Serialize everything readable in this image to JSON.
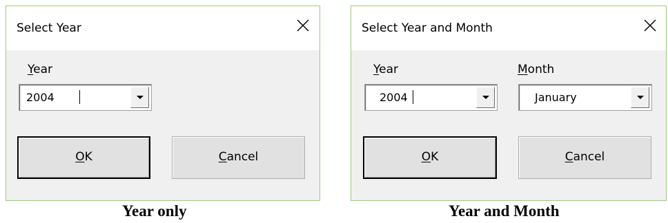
{
  "dialogs": [
    {
      "title": "Select Year",
      "year_label": {
        "mnemonic": "Y",
        "rest": "ear"
      },
      "year_value": "2004",
      "ok": {
        "mnemonic": "O",
        "rest": "K"
      },
      "cancel": {
        "mnemonic": "C",
        "rest": "ancel"
      }
    },
    {
      "title": "Select Year and Month",
      "year_label": {
        "mnemonic": "Y",
        "rest": "ear"
      },
      "year_value": "2004",
      "month_label": {
        "mnemonic": "M",
        "rest": "onth"
      },
      "month_value": "January",
      "ok": {
        "mnemonic": "O",
        "rest": "K"
      },
      "cancel": {
        "mnemonic": "C",
        "rest": "ancel"
      }
    }
  ],
  "captions": [
    "Year only",
    "Year and Month"
  ],
  "icons": {
    "close": "close-icon",
    "dropdown": "chevron-down-icon"
  },
  "colors": {
    "dialog_border": "#9bca7a",
    "dialog_body": "#f0f0f0",
    "title_bar": "#ffffff",
    "default_button_border": "#000000"
  }
}
